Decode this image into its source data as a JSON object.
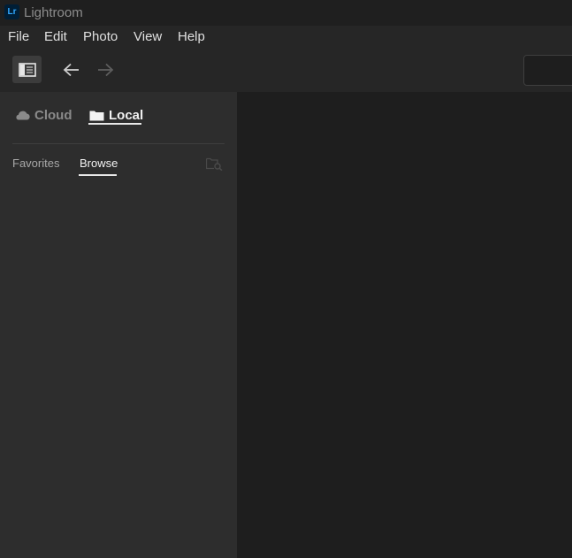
{
  "window": {
    "title": "Lightroom",
    "logo_text": "Lr",
    "colors": {
      "logo_bg": "#001e36",
      "logo_fg": "#31a8ff"
    }
  },
  "menu": {
    "items": [
      {
        "label": "File"
      },
      {
        "label": "Edit"
      },
      {
        "label": "Photo"
      },
      {
        "label": "View"
      },
      {
        "label": "Help"
      }
    ]
  },
  "toolbar": {
    "panel_toggle_icon": "sidebar-panel-icon",
    "back_icon": "arrow-left-icon",
    "forward_icon": "arrow-right-icon",
    "search_value": ""
  },
  "sidebar": {
    "source_tabs": [
      {
        "label": "Cloud",
        "icon": "cloud-icon",
        "active": false
      },
      {
        "label": "Local",
        "icon": "folder-icon",
        "active": true
      }
    ],
    "sub_tabs": [
      {
        "label": "Favorites",
        "active": false
      },
      {
        "label": "Browse",
        "active": true
      }
    ],
    "folder_search_icon": "folder-search-icon"
  }
}
